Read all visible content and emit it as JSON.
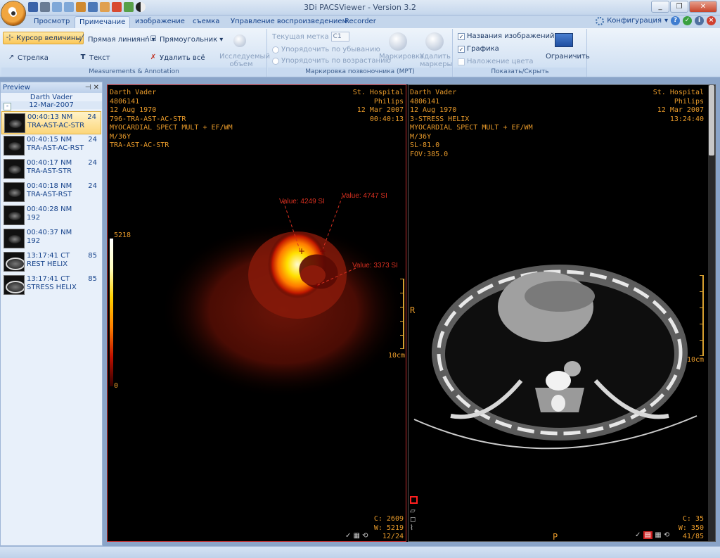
{
  "window": {
    "title": "3Di PACSViewer - Version 3.2"
  },
  "tabs": [
    "Просмотр",
    "Примечание",
    "изображение",
    "съемка",
    "Управление воспроизведением",
    "Recorder"
  ],
  "config_label": "Конфигурация",
  "ribbon": {
    "measure": {
      "title": "Measurements & Annotation",
      "ruler_cursor": "Курсор величины",
      "line": "Прямая линиянń",
      "rectangle": "Прямоугольник",
      "arrow": "Стрелка",
      "text": "Текст",
      "delete_all": "Удалить всё",
      "volume": "Исследуемый объем"
    },
    "spine": {
      "title": "Маркировка позвоночника (МРТ)",
      "current_label": "Текущая метка",
      "current_value": "C1",
      "sort_desc": "Упорядочить по убыванию",
      "sort_asc": "Упорядочить по возрастанию",
      "marking": "Маркировка",
      "delete_markers": "Удалить маркеры"
    },
    "show": {
      "title": "Показать/Скрыть",
      "image_names": "Названия изображений",
      "graphics": "Графика",
      "color_overlay": "Наложение цвета",
      "limit": "Ограничить"
    }
  },
  "preview": {
    "title": "Preview",
    "patient": "Darth Vader",
    "date": "12-Mar-2007",
    "items": [
      {
        "time": "00:40:13 NM",
        "name": "TRA-AST-AC-STR",
        "count": "24",
        "type": "nm",
        "selected": true
      },
      {
        "time": "00:40:15 NM",
        "name": "TRA-AST-AC-RST",
        "count": "24",
        "type": "nm",
        "selected": false
      },
      {
        "time": "00:40:17 NM",
        "name": "TRA-AST-STR",
        "count": "24",
        "type": "nm",
        "selected": false
      },
      {
        "time": "00:40:18 NM",
        "name": "TRA-AST-RST",
        "count": "24",
        "type": "nm",
        "selected": false
      },
      {
        "time": "00:40:28 NM",
        "name": "192",
        "count": "",
        "type": "nm",
        "selected": false
      },
      {
        "time": "00:40:37 NM",
        "name": "192",
        "count": "",
        "type": "nm",
        "selected": false
      },
      {
        "time": "13:17:41 CT",
        "name": "REST HELIX",
        "count": "85",
        "type": "ct",
        "selected": false
      },
      {
        "time": "13:17:41 CT",
        "name": "STRESS HELIX",
        "count": "85",
        "type": "ct",
        "selected": false
      }
    ]
  },
  "left_pane": {
    "info_left": [
      "Darth Vader",
      "4806141",
      "12 Aug 1970",
      "796-TRA-AST-AC-STR",
      "MYOCARDIAL SPECT MULT + EF/WM",
      "M/36Y",
      "TRA-AST-AC-STR"
    ],
    "info_right": [
      "St. Hospital",
      "Philips",
      "12 Mar 2007",
      "00:40:13"
    ],
    "colorbar_max": "5218",
    "colorbar_min": "0",
    "values": [
      "Value: 4249 SI",
      "Value: 4747 SI",
      "Value: 3373 SI"
    ],
    "scale_label": "10cm",
    "window_c": "C: 2609",
    "window_w": "W: 5219",
    "frame": "12/24"
  },
  "right_pane": {
    "info_left": [
      "Darth Vader",
      "4806141",
      "12 Aug 1970",
      "3-STRESS HELIX",
      "MYOCARDIAL SPECT MULT + EF/WM",
      "M/36Y",
      "SL-81.0",
      "FOV:385.0"
    ],
    "info_right": [
      "St. Hospital",
      "Philips",
      "12 Mar 2007",
      "13:24:40"
    ],
    "orient_r": "R",
    "orient_p": "P",
    "scale_label": "10cm",
    "window_c": "C:   35",
    "window_w": "W:  350",
    "frame": "41/85"
  },
  "colors": {
    "accent": "#e89a2a",
    "annotation": "#d83020",
    "ribbon": "#d9e6f5"
  }
}
